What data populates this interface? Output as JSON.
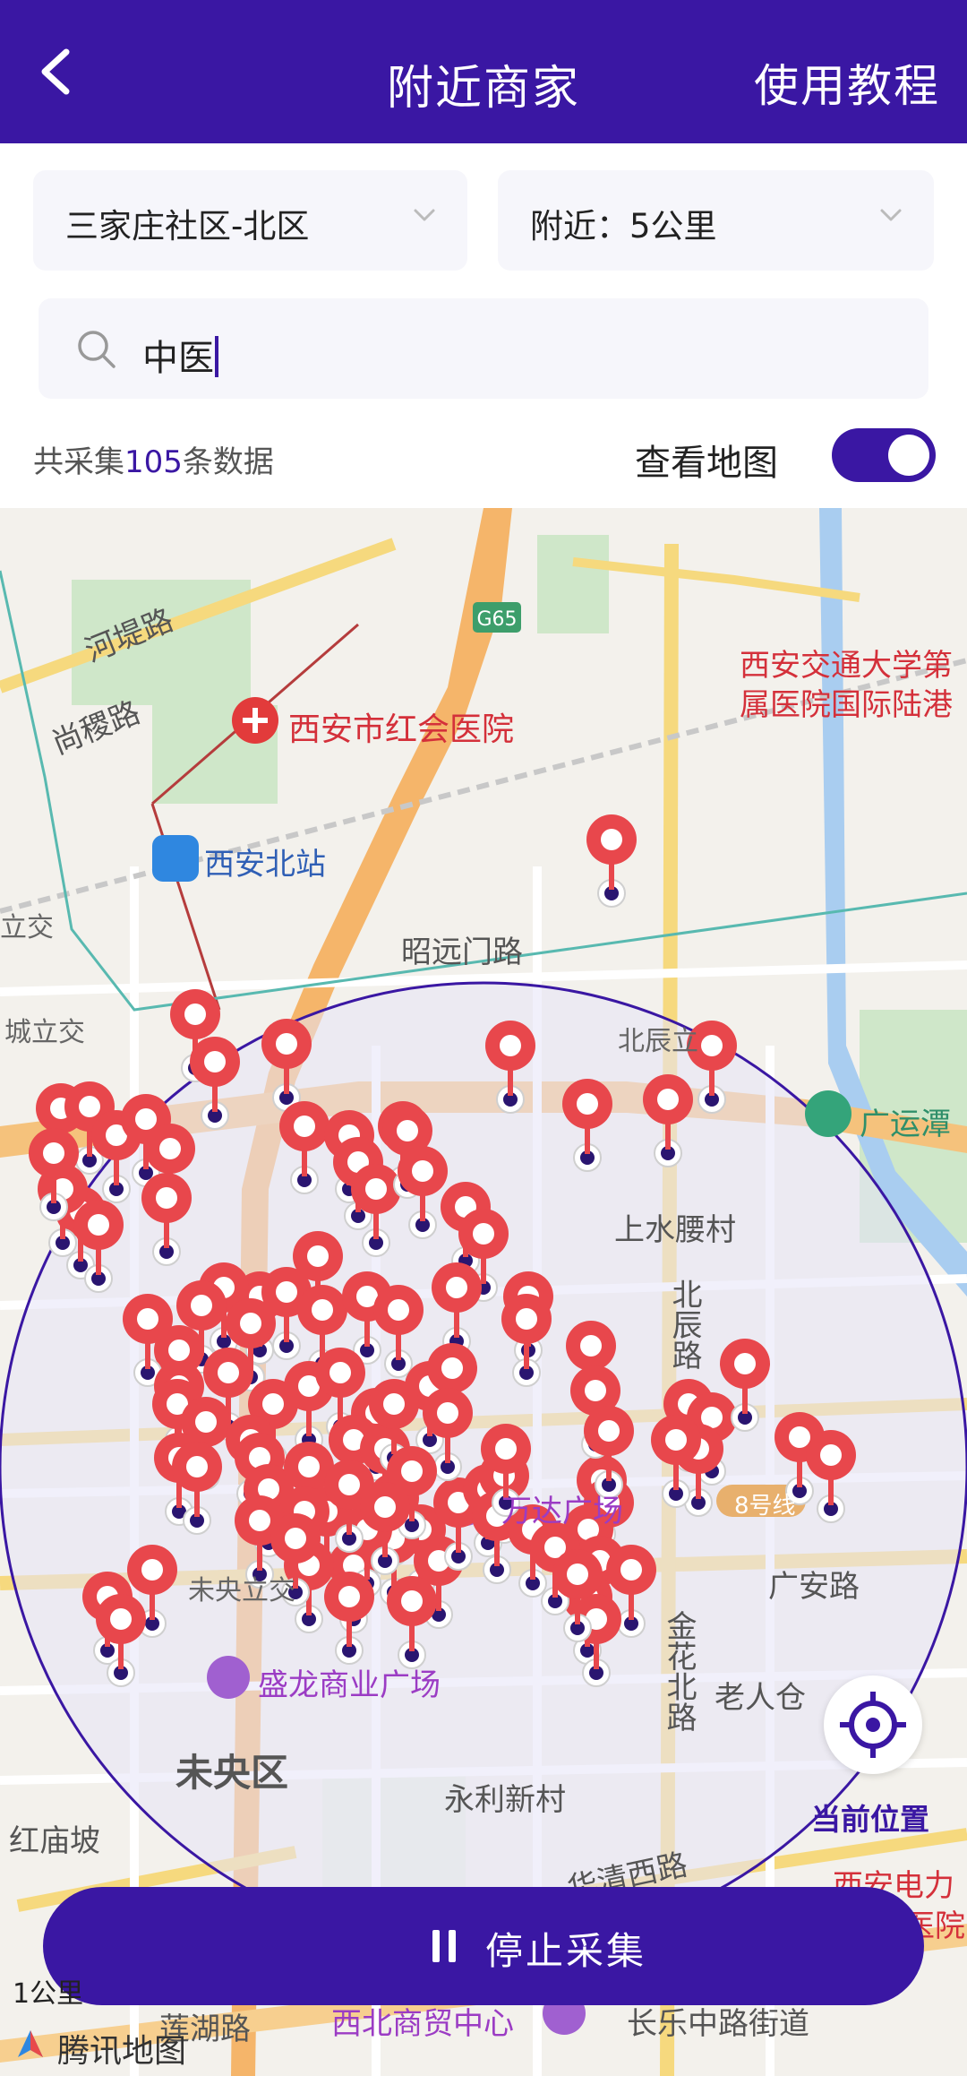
{
  "header": {
    "title": "附近商家",
    "tutorial_label": "使用教程"
  },
  "filters": {
    "community": "三家庄社区-北区",
    "radius": "附近：5公里"
  },
  "search": {
    "value": "中医"
  },
  "summary": {
    "prefix": "共采集",
    "count": "105",
    "suffix": "条数据"
  },
  "map_toggle": {
    "label": "查看地图",
    "on": true
  },
  "map": {
    "labels": {
      "hedi_road": "河堤路",
      "shangji_road": "尚稷路",
      "hospital": "西安市红会医院",
      "xian_north_station": "西安北站",
      "xjtu_hospital": "西安交通大学第",
      "xjtu_hospital_2": "属医院国际陆港",
      "li_jiao": "立交",
      "cheng_li_jiao": "城立交",
      "zhaoyuanmen_road": "昭远门路",
      "beichen": "北辰立",
      "guangyuntan": "广运潭",
      "shangshuiyao": "上水腰村",
      "beichen_road": "北辰路",
      "wanda": "万达广场",
      "metro8": "8号线",
      "weiyang_lijiao": "未央立交",
      "guangan_road": "广安路",
      "jinhua_north": "金花北路",
      "laorencang": "老人仓",
      "shenglong": "盛龙商业广场",
      "weiyang_district": "未央区",
      "yongli": "永利新村",
      "honggupo": "红庙坡",
      "huaqing_west": "华清西路",
      "xian_power": "西安电力",
      "xian_power_2": "医院",
      "lianhu_road": "莲湖路",
      "northwest_mall": "西北商贸中心",
      "changle": "长乐中路街道",
      "g65": "G65"
    },
    "marker_count": 105,
    "accent_color": "#e8474c",
    "circle_color": "#3a17a3"
  },
  "locate": {
    "label": "当前位置"
  },
  "stop_button": {
    "label": "停止采集"
  },
  "attribution": {
    "scale": "1公里",
    "provider": "腾讯地图"
  }
}
